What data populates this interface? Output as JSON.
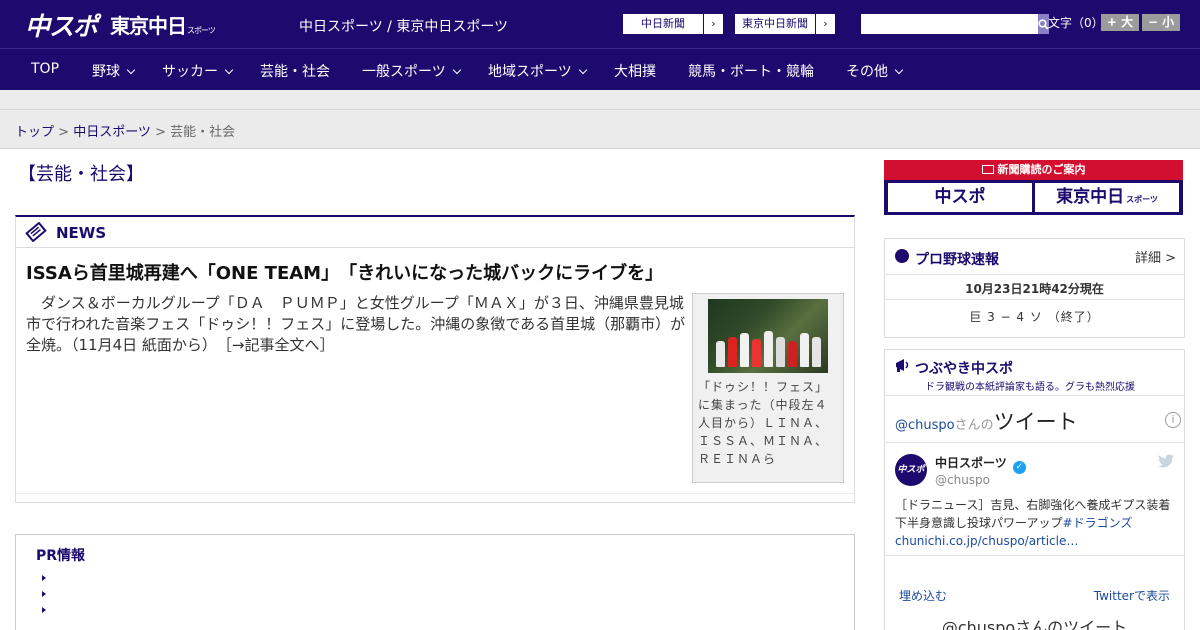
{
  "header": {
    "logo_primary": "中スポ",
    "logo_secondary": "東京中日",
    "logo_secondary_small": "スポーツ",
    "tagline": "中日スポーツ / 東京中日スポーツ",
    "newspaper_links": [
      {
        "label": "中日新聞"
      },
      {
        "label": "東京中日新聞"
      }
    ],
    "search": {
      "placeholder": "",
      "value": ""
    },
    "font_size_label": "文字（0）",
    "font_bigger": "+ 大",
    "font_smaller": "− 小"
  },
  "nav": [
    {
      "label": "TOP"
    },
    {
      "label": "野球"
    },
    {
      "label": "サッカー"
    },
    {
      "label": "芸能・社会"
    },
    {
      "label": "一般スポーツ"
    },
    {
      "label": "地域スポーツ"
    },
    {
      "label": "大相撲"
    },
    {
      "label": "競馬・ボート・競輪"
    },
    {
      "label": "その他"
    }
  ],
  "breadcrumb": {
    "home": "トップ",
    "sep": " > ",
    "section": "中日スポーツ",
    "current": "芸能・社会"
  },
  "section_title": "【芸能・社会】",
  "news": {
    "label": "NEWS",
    "headline": "ISSAら首里城再建へ「ONE TEAM」　「きれいになった城バックにライブを」",
    "body": "ダンス＆ボーカルグループ「ＤＡ　ＰＵＭＰ」と女性グループ「ＭＡＸ」が３日、沖縄県豊見城市で行われた音楽フェス「ドゥシ！！フェス」に登場した。沖縄の象徴である首里城（那覇市）が全焼。（11月4日 紙面から）",
    "more": "［→記事全文へ］",
    "caption": "「ドゥシ！！フェス」に集まった（中段左４人目から）ＬＩＮＡ、ＩＳＳＡ、ＭＩＮＡ、ＲＥＩＮＡら"
  },
  "pr": {
    "title": "PR情報"
  },
  "subscribe": {
    "title": "新聞購読のご案内",
    "btn1": "中スポ",
    "btn2": "東京中日",
    "btn2_small": "スポーツ"
  },
  "baseball": {
    "title": "プロ野球速報",
    "detail": "詳細 >",
    "time": "10月23日21時42分現在",
    "score": "巨 3 − 4 ソ （終了）"
  },
  "twitter": {
    "title": "つぶやき中スポ",
    "subtitle": "ドラ観戦の本紙評論家も語る。グラも熱烈応援",
    "account": "@chuspo",
    "account_suffix": "さんの",
    "heading": "ツイート",
    "user_name": "中日スポーツ",
    "user_handle": "@chuspo",
    "avatar_text": "中スポ",
    "tweet_text": "［ドラニュース］吉見、右脚強化へ養成ギプス装着　下半身意識し投球パワーアップ",
    "tweet_hashtag": "#ドラゴンズ",
    "tweet_link": "chunichi.co.jp/chuspo/article…",
    "embed": "埋め込む",
    "view": "Twitterで表示",
    "footer": "@chuspoさんのツイート"
  },
  "colors": {
    "brand": "#1c0a6e",
    "accent_red": "#d30f2f",
    "link": "#1c0a6e"
  }
}
